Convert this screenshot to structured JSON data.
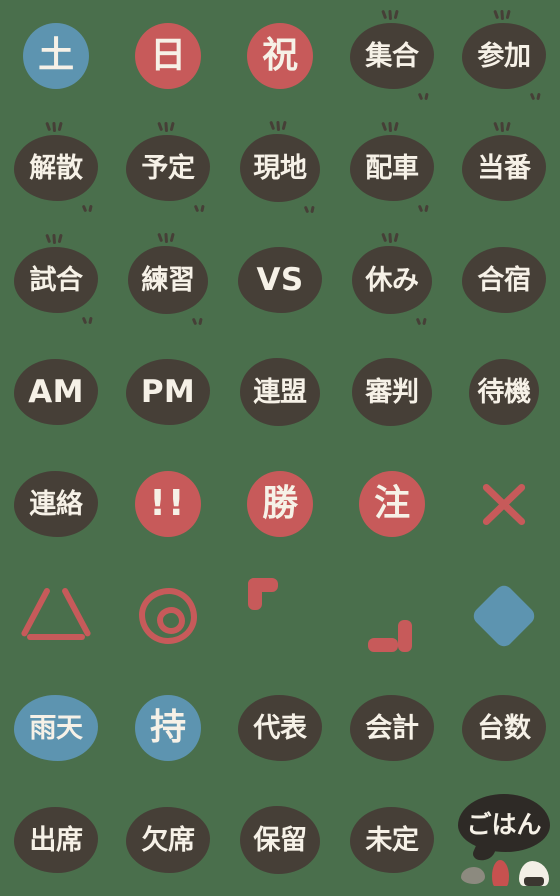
{
  "sheet": {
    "title": "Japanese schedule emoji sticker sheet",
    "background_color": "#4a6f4c",
    "columns": 5,
    "rows": 8,
    "palette": {
      "dark": "#463f37",
      "red": "#c75a5a",
      "blue": "#5d94b0",
      "cream": "#f6f1e7",
      "bubble_dark": "#2e2a26",
      "rock_gray": "#8c8a7f"
    }
  },
  "items": [
    {
      "id": "doyou",
      "label": "土",
      "shape": "circle",
      "color": "blue",
      "ticks": "none",
      "name": "emoji-doyou"
    },
    {
      "id": "nichi",
      "label": "日",
      "shape": "circle",
      "color": "red",
      "ticks": "none",
      "name": "emoji-nichiyou"
    },
    {
      "id": "shuku",
      "label": "祝",
      "shape": "circle",
      "color": "red",
      "ticks": "none",
      "name": "emoji-shukujitsu"
    },
    {
      "id": "shuugou",
      "label": "集合",
      "shape": "blob",
      "color": "dark",
      "ticks": "both",
      "name": "emoji-shuugou"
    },
    {
      "id": "sanka",
      "label": "参加",
      "shape": "blob",
      "color": "dark",
      "ticks": "both",
      "name": "emoji-sanka"
    },
    {
      "id": "kaisan",
      "label": "解散",
      "shape": "blob",
      "color": "dark",
      "ticks": "both",
      "name": "emoji-kaisan"
    },
    {
      "id": "yotei",
      "label": "予定",
      "shape": "blob",
      "color": "dark",
      "ticks": "both",
      "name": "emoji-yotei"
    },
    {
      "id": "genchi",
      "label": "現地",
      "shape": "blob2",
      "color": "dark",
      "ticks": "both",
      "name": "emoji-genchi"
    },
    {
      "id": "haisha",
      "label": "配車",
      "shape": "blob",
      "color": "dark",
      "ticks": "both",
      "name": "emoji-haisha"
    },
    {
      "id": "touban",
      "label": "当番",
      "shape": "blob",
      "color": "dark",
      "ticks": "top",
      "name": "emoji-touban"
    },
    {
      "id": "shiai",
      "label": "試合",
      "shape": "blob",
      "color": "dark",
      "ticks": "both",
      "name": "emoji-shiai"
    },
    {
      "id": "renshuu",
      "label": "練習",
      "shape": "blob2",
      "color": "dark",
      "ticks": "both",
      "name": "emoji-renshuu"
    },
    {
      "id": "vs",
      "label": "VS",
      "shape": "blob",
      "color": "dark",
      "ticks": "none",
      "name": "emoji-vs",
      "style": "latin"
    },
    {
      "id": "yasumi",
      "label": "休み",
      "shape": "blob2",
      "color": "dark",
      "ticks": "both",
      "name": "emoji-yasumi"
    },
    {
      "id": "gasshuku",
      "label": "合宿",
      "shape": "blob",
      "color": "dark",
      "ticks": "none",
      "name": "emoji-gasshuku"
    },
    {
      "id": "am",
      "label": "AM",
      "shape": "blob",
      "color": "dark",
      "ticks": "none",
      "name": "emoji-am",
      "style": "latin"
    },
    {
      "id": "pm",
      "label": "PM",
      "shape": "blob",
      "color": "dark",
      "ticks": "none",
      "name": "emoji-pm",
      "style": "latin"
    },
    {
      "id": "renmei",
      "label": "連盟",
      "shape": "blob2",
      "color": "dark",
      "ticks": "none",
      "name": "emoji-renmei"
    },
    {
      "id": "shinpan",
      "label": "審判",
      "shape": "blob2",
      "color": "dark",
      "ticks": "none",
      "name": "emoji-shinpan"
    },
    {
      "id": "taiki",
      "label": "待機",
      "shape": "blob-narrow",
      "color": "dark",
      "ticks": "none",
      "name": "emoji-taiki"
    },
    {
      "id": "renraku",
      "label": "連絡",
      "shape": "blob",
      "color": "dark",
      "ticks": "none",
      "name": "emoji-renraku"
    },
    {
      "id": "bikkuri",
      "label": "!!",
      "shape": "circle",
      "color": "red",
      "ticks": "none",
      "name": "emoji-double-exclamation",
      "style": "bang"
    },
    {
      "id": "kachi",
      "label": "勝",
      "shape": "circle",
      "color": "red",
      "ticks": "none",
      "name": "emoji-kachi",
      "style": "single"
    },
    {
      "id": "chuu",
      "label": "注",
      "shape": "circle",
      "color": "red",
      "ticks": "none",
      "name": "emoji-chuui",
      "style": "single"
    },
    {
      "id": "batsu",
      "label": "×",
      "shape": "symbol-x",
      "color": "red",
      "ticks": "none",
      "name": "emoji-batsu-x"
    },
    {
      "id": "sankaku",
      "label": "△",
      "shape": "symbol-triangle",
      "color": "red",
      "ticks": "none",
      "name": "emoji-sankaku-triangle"
    },
    {
      "id": "nijuumaru",
      "label": "◎",
      "shape": "symbol-double-circle",
      "color": "red",
      "ticks": "none",
      "name": "emoji-nijuumaru"
    },
    {
      "id": "kagi-open",
      "label": "「",
      "shape": "symbol-bracket-open",
      "color": "red",
      "ticks": "none",
      "name": "emoji-kagikakko-open"
    },
    {
      "id": "kagi-close",
      "label": "」",
      "shape": "symbol-bracket-close",
      "color": "red",
      "ticks": "none",
      "name": "emoji-kagikakko-close"
    },
    {
      "id": "hishigata",
      "label": "◆",
      "shape": "symbol-diamond",
      "color": "blue",
      "ticks": "none",
      "name": "emoji-diamond"
    },
    {
      "id": "uten",
      "label": "雨天",
      "shape": "blob",
      "color": "blue",
      "ticks": "none",
      "name": "emoji-uten"
    },
    {
      "id": "mochi",
      "label": "持",
      "shape": "circle",
      "color": "blue",
      "ticks": "none",
      "name": "emoji-mochimono",
      "style": "single"
    },
    {
      "id": "daihyou",
      "label": "代表",
      "shape": "blob",
      "color": "dark",
      "ticks": "none",
      "name": "emoji-daihyou"
    },
    {
      "id": "kaikei",
      "label": "会計",
      "shape": "blob",
      "color": "dark",
      "ticks": "none",
      "name": "emoji-kaikei"
    },
    {
      "id": "daisuu",
      "label": "台数",
      "shape": "blob",
      "color": "dark",
      "ticks": "none",
      "name": "emoji-daisuu"
    },
    {
      "id": "shusseki",
      "label": "出席",
      "shape": "blob",
      "color": "dark",
      "ticks": "none",
      "name": "emoji-shusseki"
    },
    {
      "id": "kesseki",
      "label": "欠席",
      "shape": "blob",
      "color": "dark",
      "ticks": "none",
      "name": "emoji-kesseki"
    },
    {
      "id": "horyuu",
      "label": "保留",
      "shape": "blob2",
      "color": "dark",
      "ticks": "none",
      "name": "emoji-horyuu"
    },
    {
      "id": "mitei",
      "label": "未定",
      "shape": "blob",
      "color": "dark",
      "ticks": "none",
      "name": "emoji-mitei"
    },
    {
      "id": "gohan",
      "label": "ごはん",
      "shape": "gohan",
      "color": "dark",
      "ticks": "none",
      "name": "emoji-gohan"
    }
  ]
}
